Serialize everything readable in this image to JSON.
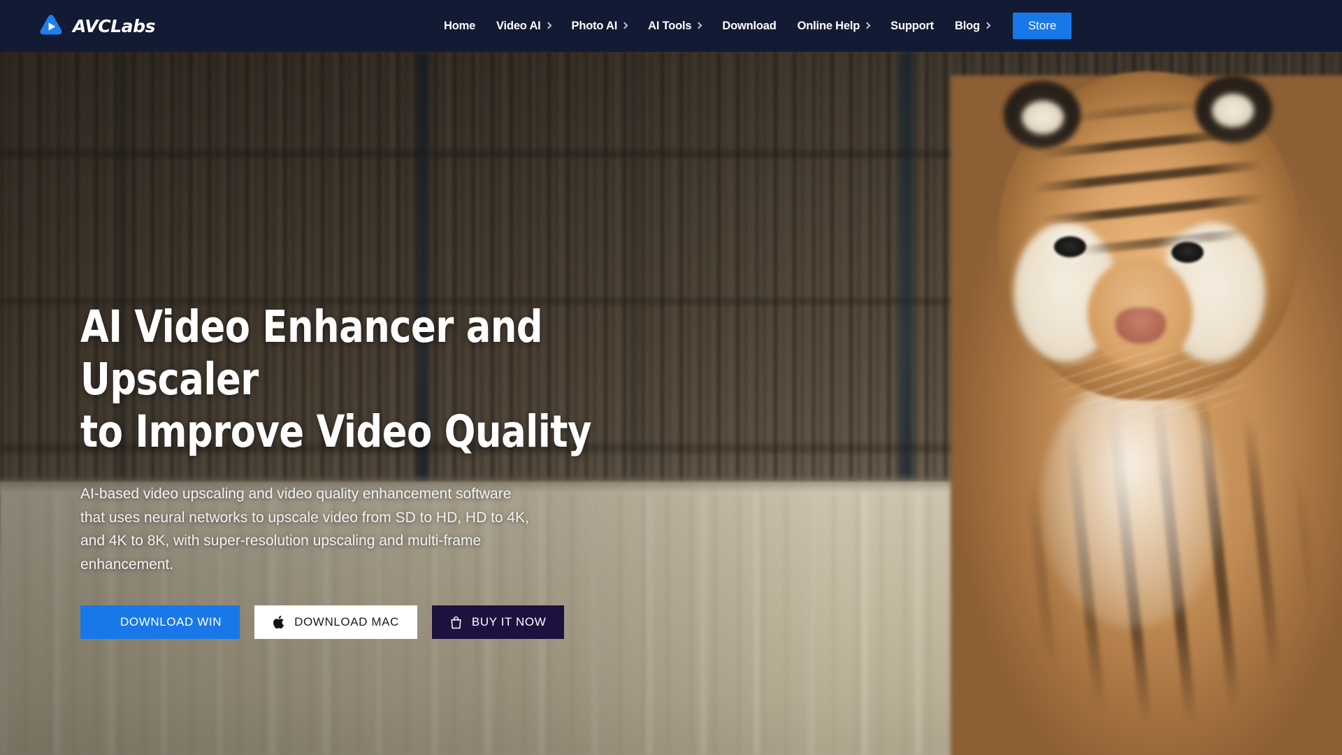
{
  "header": {
    "brand": {
      "name": "AVCLabs",
      "logo_icon": "play-triangle-logo-icon"
    },
    "nav": [
      {
        "label": "Home",
        "has_dropdown": false
      },
      {
        "label": "Video AI",
        "has_dropdown": true
      },
      {
        "label": "Photo AI",
        "has_dropdown": true
      },
      {
        "label": "AI Tools",
        "has_dropdown": true
      },
      {
        "label": "Download",
        "has_dropdown": false
      },
      {
        "label": "Online Help",
        "has_dropdown": true
      },
      {
        "label": "Support",
        "has_dropdown": false
      },
      {
        "label": "Blog",
        "has_dropdown": true
      }
    ],
    "store_button": "Store",
    "colors": {
      "bar_bg": "#131a33",
      "store_bg": "#1878e8",
      "text": "#ffffff"
    }
  },
  "hero": {
    "headline_line1": "AI Video Enhancer and Upscaler",
    "headline_line2": "to Improve Video Quality",
    "description": "AI-based video upscaling and video quality enhancement software that uses neural networks to upscale video from SD to HD, HD to 4K, and 4K to 8K, with super-resolution upscaling and multi-frame enhancement.",
    "buttons": [
      {
        "label": "DOWNLOAD WIN",
        "icon": "windows-icon",
        "bg": "#1878e8",
        "fg": "#ffffff"
      },
      {
        "label": "DOWNLOAD MAC",
        "icon": "apple-icon",
        "bg": "#ffffff",
        "fg": "#1b1b1b"
      },
      {
        "label": "BUY IT NOW",
        "icon": "shopping-bag-icon",
        "bg": "#1d1140",
        "fg": "#ffffff"
      }
    ],
    "background_image": "blurred video still of a tiger walking beside a fence above a concrete wall"
  }
}
